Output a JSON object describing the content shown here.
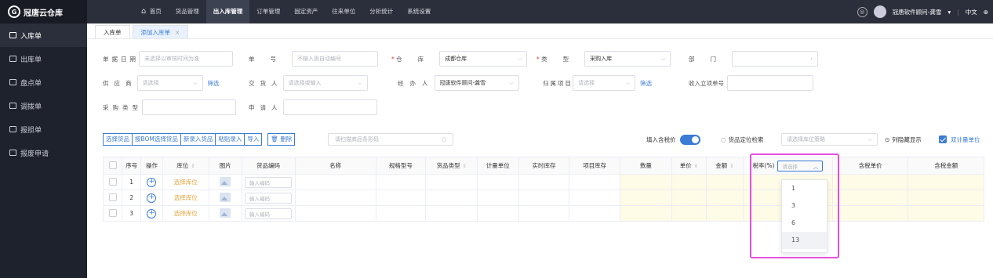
{
  "app": {
    "title": "冠唐云仓库",
    "logo_letter": "G"
  },
  "sidebar": {
    "items": [
      {
        "label": "入库单",
        "active": true
      },
      {
        "label": "出库单"
      },
      {
        "label": "盘点单"
      },
      {
        "label": "调拨单"
      },
      {
        "label": "报损单"
      },
      {
        "label": "报废申请"
      }
    ]
  },
  "topnav": {
    "items": [
      "首页",
      "货品管理",
      "出入库管理",
      "订单管理",
      "固定资产",
      "往来单位",
      "分析统计",
      "系统设置"
    ],
    "active": "出入库管理"
  },
  "user": {
    "name": "冠唐软件顾问-龚雪",
    "lang": "中文"
  },
  "tabs": [
    {
      "label": "入库单"
    },
    {
      "label": "添加入库单",
      "close": "×",
      "active": true
    }
  ],
  "form": {
    "date": {
      "label": "单据日期",
      "placeholder": "未选择以审核时间为准"
    },
    "no": {
      "label": "单号",
      "placeholder": "不输入则自动编号"
    },
    "warehouse": {
      "label": "仓库",
      "value": "成都仓库"
    },
    "type": {
      "label": "类型",
      "value": "采购入库"
    },
    "dept": {
      "label": "部门",
      "value": ""
    },
    "supplier": {
      "label": "供应商",
      "placeholder": "请选择",
      "filter": "筛选"
    },
    "deliverer": {
      "label": "交货人",
      "placeholder": "请选择或输入"
    },
    "handler": {
      "label": "经办人",
      "value": "冠唐软件顾问-龚雪"
    },
    "project": {
      "label": "归属项目",
      "placeholder": "请选择",
      "filter": "筛选"
    },
    "recv_no": {
      "label": "收入立项单号",
      "value": ""
    },
    "purchase_type": {
      "label": "采购类型",
      "value": ""
    },
    "applicant": {
      "label": "申请人",
      "value": ""
    }
  },
  "toolbar": {
    "buttons": [
      "选择货品",
      "按BOM选择货品",
      "新录入货品",
      "粘贴录入",
      "导入"
    ],
    "delete": "删除",
    "scan_placeholder": "请扫描商品条形码",
    "tax_price_label": "填入含税价",
    "locate_label": "货品定位检索",
    "locate_placeholder": "请选择库位策略",
    "hide_cols": "列隐藏显示",
    "dual_unit": "双计量单位"
  },
  "table": {
    "columns": [
      "序号",
      "操作",
      "库位",
      "图片",
      "货品编码",
      "名称",
      "规格型号",
      "货品类型",
      "计量单位",
      "实时库存",
      "项目库存",
      "数量",
      "单价",
      "金额",
      "税率(%)",
      "含税单价",
      "含税金额"
    ],
    "tax_placeholder": "请选择",
    "rows": [
      {
        "no": "1",
        "loc": "选择库位",
        "code": "输入编码"
      },
      {
        "no": "2",
        "loc": "选择库位",
        "code": "输入编码"
      },
      {
        "no": "3",
        "loc": "选择库位",
        "code": "输入编码"
      }
    ]
  },
  "tax_dropdown": {
    "options": [
      "1",
      "3",
      "6",
      "13"
    ],
    "hovered": "13"
  }
}
